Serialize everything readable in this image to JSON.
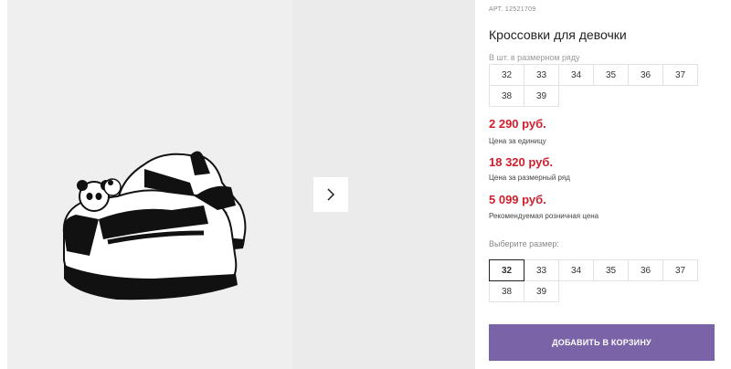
{
  "product": {
    "article_label": "АРТ.",
    "article_number": "12521709",
    "title": "Кроссовки для девочки"
  },
  "pack_sizes": {
    "caption": "В шт. в размерном ряду",
    "sizes": [
      "32",
      "33",
      "34",
      "35",
      "36",
      "37",
      "38",
      "39"
    ]
  },
  "prices": {
    "unit_price": "2 290 руб.",
    "unit_label": "Цена за единицу",
    "pack_price": "18 320 руб.",
    "pack_label": "Цена за размерный ряд",
    "retail_price": "5 099 руб.",
    "retail_label": "Рекомендуемая розничная цена",
    "price_color": "#d0202f"
  },
  "size_picker": {
    "label": "Выберите размер:",
    "sizes": [
      "32",
      "33",
      "34",
      "35",
      "36",
      "37",
      "38",
      "39"
    ],
    "selected": "32"
  },
  "cart_button": {
    "label": "ДОБАВИТЬ В КОРЗИНУ",
    "color": "#7a63a6"
  },
  "gallery": {
    "next_icon": "chevron-right-icon"
  }
}
